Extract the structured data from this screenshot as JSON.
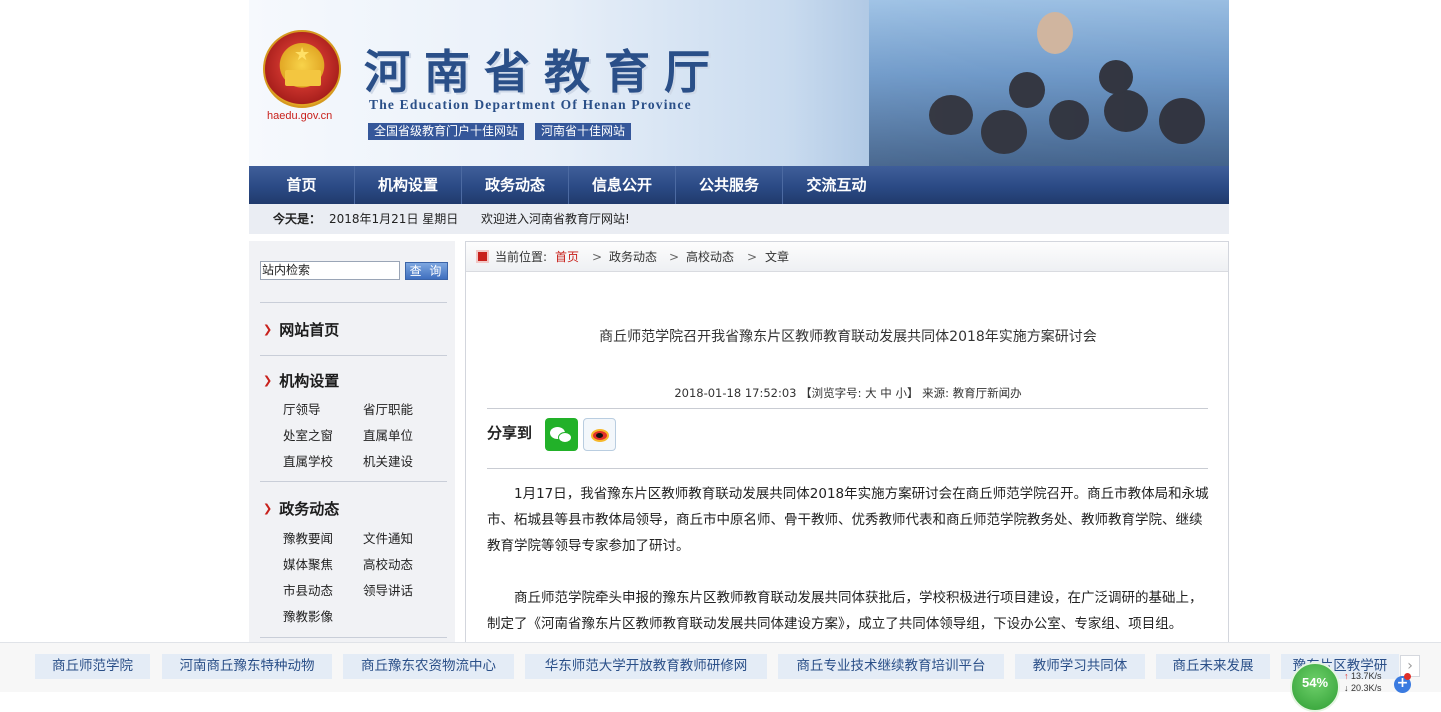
{
  "header": {
    "domain": "haedu.gov.cn",
    "brand_cn": "河南省教育厅",
    "brand_en": "The Education Department Of Henan Province",
    "tags": [
      "全国省级教育门户十佳网站",
      "河南省十佳网站"
    ]
  },
  "nav": [
    "首页",
    "机构设置",
    "政务动态",
    "信息公开",
    "公共服务",
    "交流互动"
  ],
  "datebar": {
    "label": "今天是：",
    "date": "2018年1月21日 星期日",
    "welcome": "欢迎进入河南省教育厅网站!"
  },
  "sidebar": {
    "search_value": "站内检索",
    "search_button": "查 询",
    "sections": [
      {
        "title": "网站首页",
        "items": []
      },
      {
        "title": "机构设置",
        "items": [
          "厅领导",
          "省厅职能",
          "处室之窗",
          "直属单位",
          "直属学校",
          "机关建设"
        ]
      },
      {
        "title": "政务动态",
        "items": [
          "豫教要闻",
          "文件通知",
          "媒体聚焦",
          "高校动态",
          "市县动态",
          "领导讲话",
          "豫教影像"
        ]
      }
    ]
  },
  "breadcrumb": {
    "label": "当前位置:",
    "items": [
      "首页",
      "政务动态",
      "高校动态",
      "文章"
    ],
    "separator": ">"
  },
  "article": {
    "title": "商丘师范学院召开我省豫东片区教师教育联动发展共同体2018年实施方案研讨会",
    "meta": "2018-01-18 17:52:03 【浏览字号: 大 中 小】 来源: 教育厅新闻办",
    "share_label": "分享到",
    "paragraphs": [
      "1月17日，我省豫东片区教师教育联动发展共同体2018年实施方案研讨会在商丘师范学院召开。商丘市教体局和永城市、柘城县等县市教体局领导，商丘市中原名师、骨干教师、优秀教师代表和商丘师范学院教务处、教师教育学院、继续教育学院等领导专家参加了研讨。",
      "商丘师范学院牵头申报的豫东片区教师教育联动发展共同体获批后，学校积极进行项目建设，在广泛调研的基础上，制定了《河南省豫东片区教师教育联动发展共同体建设方案》，成立了共同体领导组，下设办公室、专家组、项目组。"
    ]
  },
  "bottom_links": [
    "商丘师范学院",
    "河南商丘豫东特种动物",
    "商丘豫东农资物流中心",
    "华东师范大学开放教育教师研修网",
    "商丘专业技术继续教育培训平台",
    "教师学习共同体",
    "商丘未来发展",
    "豫东片区教学研"
  ],
  "system": {
    "percent": "54%",
    "up": "13.7K/s",
    "down": "20.3K/s"
  }
}
